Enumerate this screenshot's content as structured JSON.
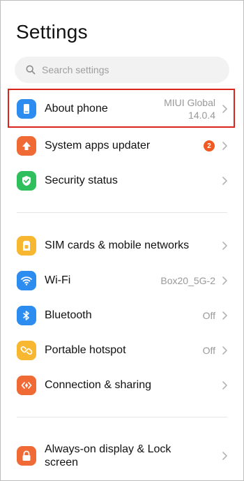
{
  "header": {
    "title": "Settings"
  },
  "search": {
    "placeholder": "Search settings"
  },
  "items": [
    {
      "label": "About phone",
      "value_line1": "MIUI Global",
      "value_line2": "14.0.4",
      "icon": "phone-icon",
      "color": "#2d8cf0"
    },
    {
      "label": "System apps updater",
      "badge": "2",
      "icon": "arrow-up-icon",
      "color": "#f06a35"
    },
    {
      "label": "Security status",
      "icon": "shield-check-icon",
      "color": "#2fbf5d"
    },
    {
      "label": "SIM cards & mobile networks",
      "icon": "sim-card-icon",
      "color": "#f7b731"
    },
    {
      "label": "Wi-Fi",
      "value": "Box20_5G-2",
      "icon": "wifi-icon",
      "color": "#2d8cf0"
    },
    {
      "label": "Bluetooth",
      "value": "Off",
      "icon": "bluetooth-icon",
      "color": "#2d8cf0"
    },
    {
      "label": "Portable hotspot",
      "value": "Off",
      "icon": "hotspot-link-icon",
      "color": "#f7b731"
    },
    {
      "label": "Connection & sharing",
      "icon": "connection-icon",
      "color": "#f06a35"
    },
    {
      "label": "Always-on display & Lock screen",
      "icon": "lock-icon",
      "color": "#f06a35"
    }
  ],
  "highlight_color": "#d9241c"
}
